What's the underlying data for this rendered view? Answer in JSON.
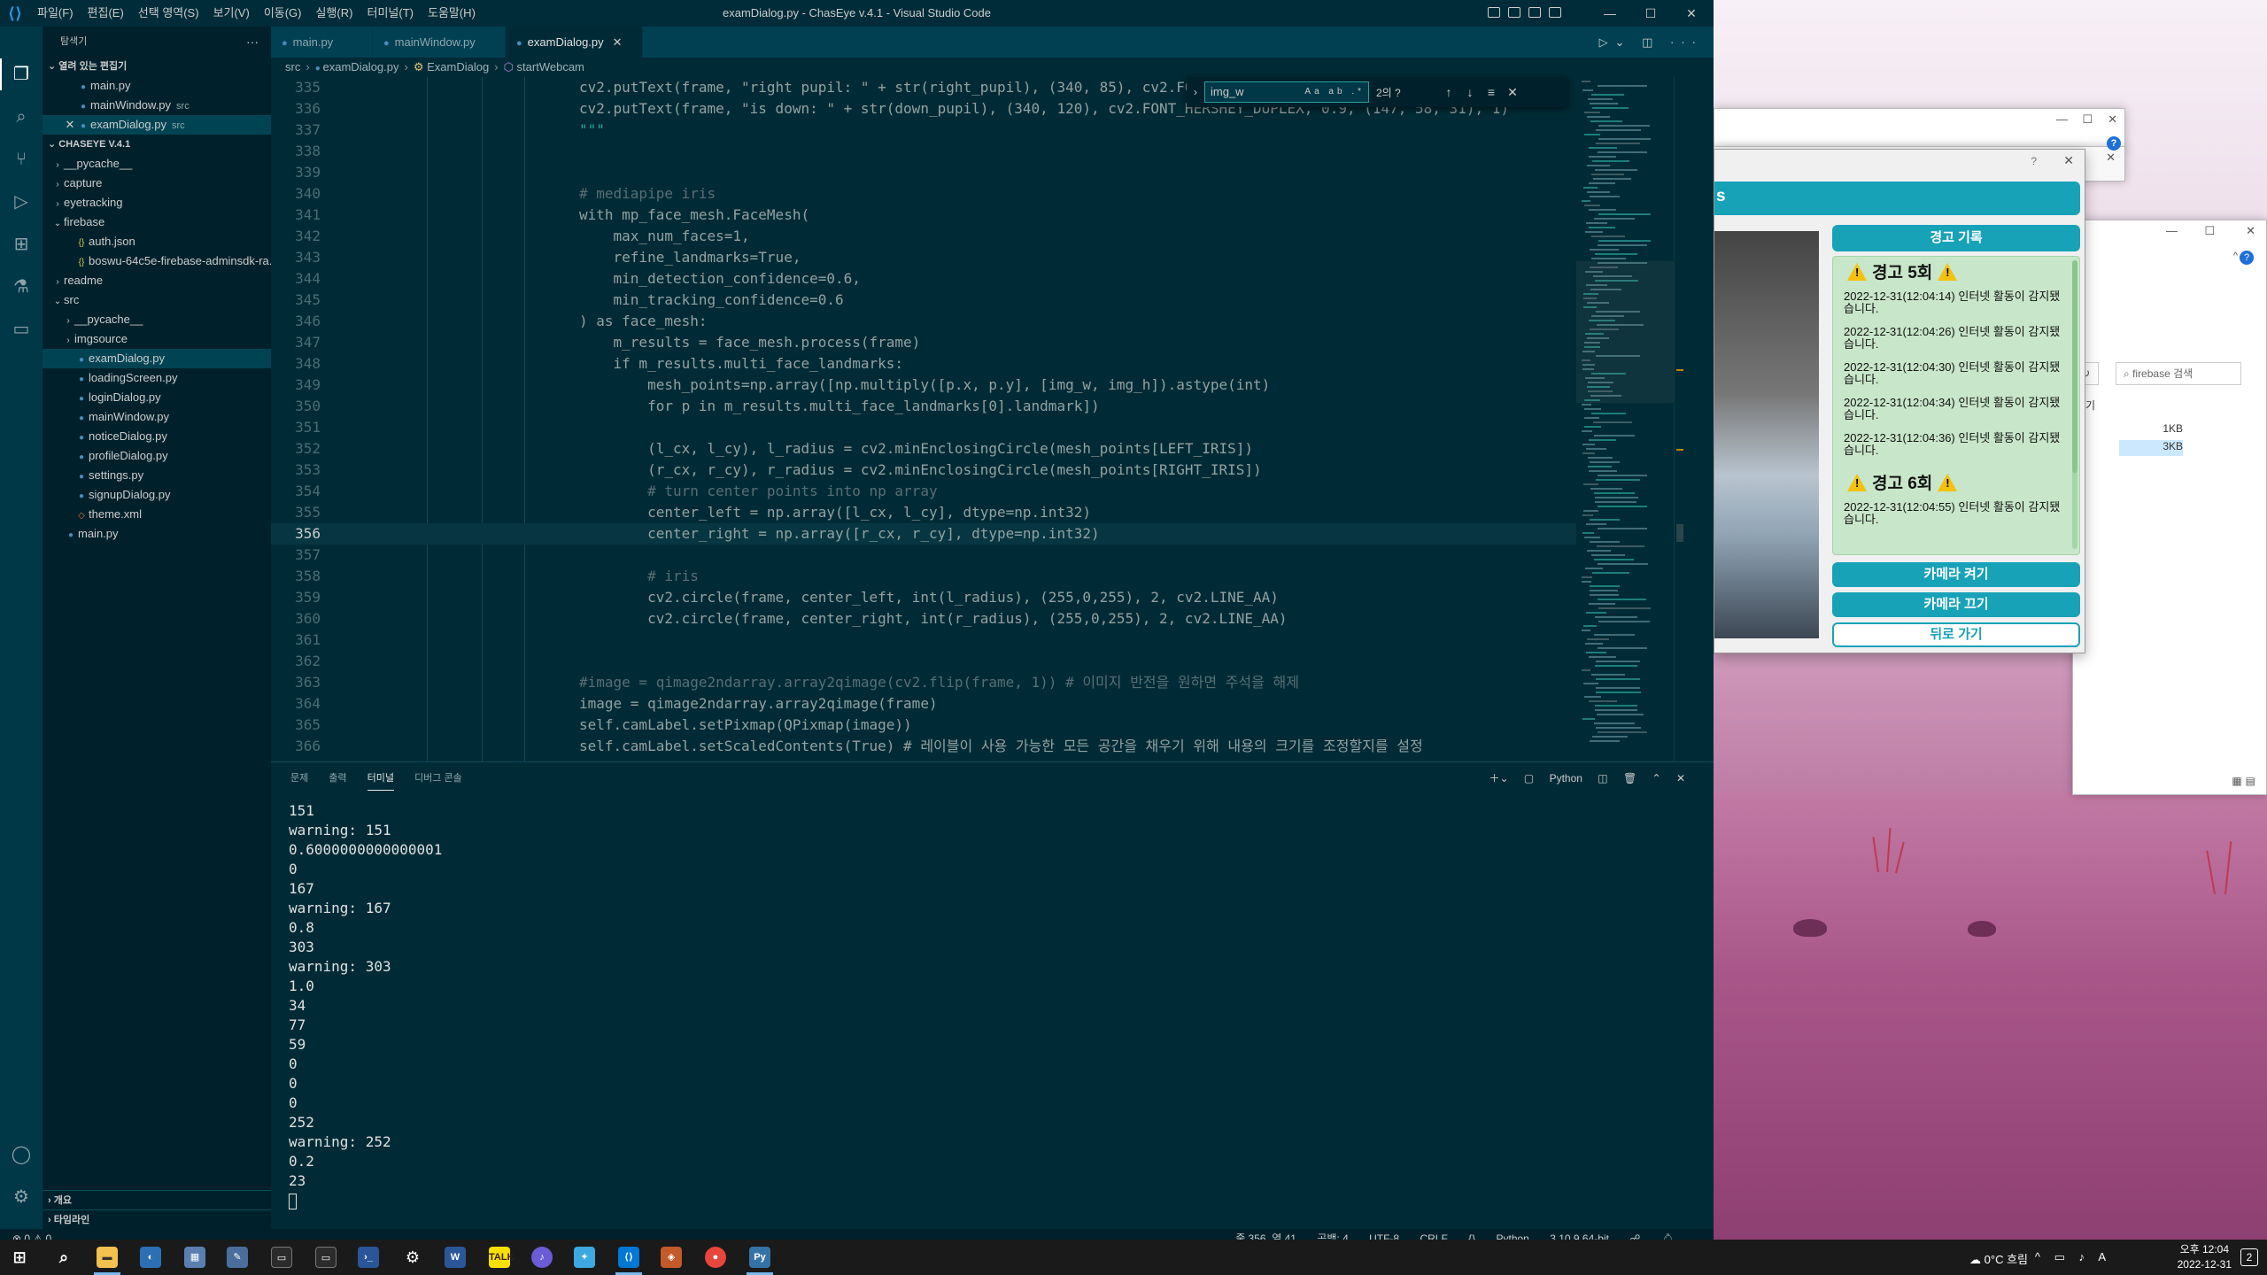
{
  "window": {
    "title": "examDialog.py - ChasEye v.4.1 - Visual Studio Code",
    "menu": [
      "파일(F)",
      "편집(E)",
      "선택 영역(S)",
      "보기(V)",
      "이동(G)",
      "실행(R)",
      "터미널(T)",
      "도움말(H)"
    ]
  },
  "sidebar": {
    "title": "탐색기",
    "open_editors_label": "열려 있는 편집기",
    "open_editors": [
      {
        "name": "main.py",
        "desc": ""
      },
      {
        "name": "mainWindow.py",
        "desc": "src"
      },
      {
        "name": "examDialog.py",
        "desc": "src"
      }
    ],
    "project_label": "CHASEYE V.4.1",
    "tree": [
      {
        "name": "__pycache__",
        "type": "folder",
        "level": 1
      },
      {
        "name": "capture",
        "type": "folder",
        "level": 1
      },
      {
        "name": "eyetracking",
        "type": "folder",
        "level": 1
      },
      {
        "name": "firebase",
        "type": "folder-open",
        "level": 1
      },
      {
        "name": "auth.json",
        "type": "json",
        "level": 2
      },
      {
        "name": "boswu-64c5e-firebase-adminsdk-ra...",
        "type": "json",
        "level": 2
      },
      {
        "name": "readme",
        "type": "folder",
        "level": 1
      },
      {
        "name": "src",
        "type": "folder-open",
        "level": 1
      },
      {
        "name": "__pycache__",
        "type": "folder",
        "level": 2
      },
      {
        "name": "imgsource",
        "type": "folder",
        "level": 2
      },
      {
        "name": "examDialog.py",
        "type": "py",
        "level": 2
      },
      {
        "name": "loadingScreen.py",
        "type": "py",
        "level": 2
      },
      {
        "name": "loginDialog.py",
        "type": "py",
        "level": 2
      },
      {
        "name": "mainWindow.py",
        "type": "py",
        "level": 2
      },
      {
        "name": "noticeDialog.py",
        "type": "py",
        "level": 2
      },
      {
        "name": "profileDialog.py",
        "type": "py",
        "level": 2
      },
      {
        "name": "settings.py",
        "type": "py",
        "level": 2
      },
      {
        "name": "signupDialog.py",
        "type": "py",
        "level": 2
      },
      {
        "name": "theme.xml",
        "type": "xml",
        "level": 2
      },
      {
        "name": "main.py",
        "type": "py",
        "level": 1
      }
    ],
    "outline_label": "개요",
    "timeline_label": "타임라인"
  },
  "tabs": [
    "main.py",
    "mainWindow.py",
    "examDialog.py"
  ],
  "breadcrumb": [
    "src",
    "examDialog.py",
    "ExamDialog",
    "startWebcam"
  ],
  "find": {
    "query": "img_w",
    "count": "2의 ?"
  },
  "code_lines": [
    {
      "n": "335",
      "t": "cv2.putText(frame, \"right pupil: \" + str(right_pupil), (340, 85), cv2.FONT_HERSHEY_DUPLEX, 0.9, (147, 58, 31), 1)"
    },
    {
      "n": "336",
      "t": "cv2.putText(frame, \"is down: \" + str(down_pupil), (340, 120), cv2.FONT_HERSHEY_DUPLEX, 0.9, (147, 58, 31), 1)"
    },
    {
      "n": "337",
      "t": "\"\"\""
    },
    {
      "n": "338",
      "t": ""
    },
    {
      "n": "339",
      "t": ""
    },
    {
      "n": "340",
      "t": "# mediapipe iris"
    },
    {
      "n": "341",
      "t": "with mp_face_mesh.FaceMesh("
    },
    {
      "n": "342",
      "t": "    max_num_faces=1,"
    },
    {
      "n": "343",
      "t": "    refine_landmarks=True,"
    },
    {
      "n": "344",
      "t": "    min_detection_confidence=0.6,"
    },
    {
      "n": "345",
      "t": "    min_tracking_confidence=0.6"
    },
    {
      "n": "346",
      "t": ") as face_mesh:"
    },
    {
      "n": "347",
      "t": "    m_results = face_mesh.process(frame)"
    },
    {
      "n": "348",
      "t": "    if m_results.multi_face_landmarks:"
    },
    {
      "n": "349",
      "t": "        mesh_points=np.array([np.multiply([p.x, p.y], [img_w, img_h]).astype(int)"
    },
    {
      "n": "350",
      "t": "        for p in m_results.multi_face_landmarks[0].landmark])"
    },
    {
      "n": "351",
      "t": ""
    },
    {
      "n": "352",
      "t": "        (l_cx, l_cy), l_radius = cv2.minEnclosingCircle(mesh_points[LEFT_IRIS])"
    },
    {
      "n": "353",
      "t": "        (r_cx, r_cy), r_radius = cv2.minEnclosingCircle(mesh_points[RIGHT_IRIS])"
    },
    {
      "n": "354",
      "t": "        # turn center points into np array"
    },
    {
      "n": "355",
      "t": "        center_left = np.array([l_cx, l_cy], dtype=np.int32)"
    },
    {
      "n": "356",
      "t": "        center_right = np.array([r_cx, r_cy], dtype=np.int32)"
    },
    {
      "n": "357",
      "t": ""
    },
    {
      "n": "358",
      "t": "        # iris"
    },
    {
      "n": "359",
      "t": "        cv2.circle(frame, center_left, int(l_radius), (255,0,255), 2, cv2.LINE_AA)"
    },
    {
      "n": "360",
      "t": "        cv2.circle(frame, center_right, int(r_radius), (255,0,255), 2, cv2.LINE_AA)"
    },
    {
      "n": "361",
      "t": ""
    },
    {
      "n": "362",
      "t": ""
    },
    {
      "n": "363",
      "t": "#image = qimage2ndarray.array2qimage(cv2.flip(frame, 1)) # 이미지 반전을 원하면 주석을 해제"
    },
    {
      "n": "364",
      "t": "image = qimage2ndarray.array2qimage(frame)"
    },
    {
      "n": "365",
      "t": "self.camLabel.setPixmap(QPixmap(image))"
    },
    {
      "n": "366",
      "t": "self.camLabel.setScaledContents(True) # 레이블이 사용 가능한 모든 공간을 채우기 위해 내용의 크기를 조정할지를 설정"
    },
    {
      "n": "367",
      "t": ""
    }
  ],
  "panel": {
    "tabs": [
      "문제",
      "출력",
      "터미널",
      "디버그 콘솔"
    ],
    "active_tab": "터미널",
    "shell_label": "Python",
    "terminal_lines": [
      "151",
      "warning: 151",
      "0.6000000000000001",
      "0",
      "167",
      "warning: 167",
      "0.8",
      "303",
      "warning: 303",
      "1.0",
      "34",
      "77",
      "59",
      "0",
      "0",
      "0",
      "252",
      "warning: 252",
      "0.2",
      "23"
    ]
  },
  "statusbar": {
    "problems": "⊗ 0 ⚠ 0",
    "position": "줄 356, 열 41",
    "spaces": "공백: 4",
    "encoding": "UTF-8",
    "eol": "CRLF",
    "language": "Python",
    "interpreter": "3.10.9 64-bit"
  },
  "exam_dialog": {
    "title_glyph": "?",
    "header_partial": "s",
    "warning_log_title": "경고 기록",
    "groups": [
      {
        "heading": "경고 5회",
        "entries": [
          "2022-12-31(12:04:14) 인터넷 활동이 감지됐습니다.",
          "2022-12-31(12:04:26) 인터넷 활동이 감지됐습니다.",
          "2022-12-31(12:04:30) 인터넷 활동이 감지됐습니다.",
          "2022-12-31(12:04:34) 인터넷 활동이 감지됐습니다.",
          "2022-12-31(12:04:36) 인터넷 활동이 감지됐습니다."
        ]
      },
      {
        "heading": "경고 6회",
        "entries": [
          "2022-12-31(12:04:55) 인터넷 활동이 감지됐습니다."
        ]
      }
    ],
    "btn_camera_on": "카메라 켜기",
    "btn_camera_off": "카메라 끄기",
    "btn_back": "뒤로 가기"
  },
  "explorer_window": {
    "search_placeholder": "firebase 검색",
    "size_1": "1KB",
    "size_2": "3KB",
    "partial_label": "기"
  },
  "taskbar": {
    "weather": "0°C 흐림",
    "ime": "A",
    "time": "오후 12:04",
    "date": "2022-12-31",
    "notify": "2"
  }
}
